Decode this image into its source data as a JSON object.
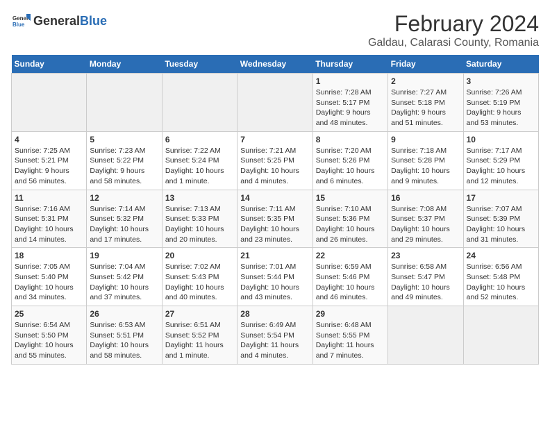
{
  "header": {
    "logo_general": "General",
    "logo_blue": "Blue",
    "title": "February 2024",
    "subtitle": "Galdau, Calarasi County, Romania"
  },
  "weekdays": [
    "Sunday",
    "Monday",
    "Tuesday",
    "Wednesday",
    "Thursday",
    "Friday",
    "Saturday"
  ],
  "weeks": [
    [
      {
        "day": "",
        "info": ""
      },
      {
        "day": "",
        "info": ""
      },
      {
        "day": "",
        "info": ""
      },
      {
        "day": "",
        "info": ""
      },
      {
        "day": "1",
        "info": "Sunrise: 7:28 AM\nSunset: 5:17 PM\nDaylight: 9 hours\nand 48 minutes."
      },
      {
        "day": "2",
        "info": "Sunrise: 7:27 AM\nSunset: 5:18 PM\nDaylight: 9 hours\nand 51 minutes."
      },
      {
        "day": "3",
        "info": "Sunrise: 7:26 AM\nSunset: 5:19 PM\nDaylight: 9 hours\nand 53 minutes."
      }
    ],
    [
      {
        "day": "4",
        "info": "Sunrise: 7:25 AM\nSunset: 5:21 PM\nDaylight: 9 hours\nand 56 minutes."
      },
      {
        "day": "5",
        "info": "Sunrise: 7:23 AM\nSunset: 5:22 PM\nDaylight: 9 hours\nand 58 minutes."
      },
      {
        "day": "6",
        "info": "Sunrise: 7:22 AM\nSunset: 5:24 PM\nDaylight: 10 hours\nand 1 minute."
      },
      {
        "day": "7",
        "info": "Sunrise: 7:21 AM\nSunset: 5:25 PM\nDaylight: 10 hours\nand 4 minutes."
      },
      {
        "day": "8",
        "info": "Sunrise: 7:20 AM\nSunset: 5:26 PM\nDaylight: 10 hours\nand 6 minutes."
      },
      {
        "day": "9",
        "info": "Sunrise: 7:18 AM\nSunset: 5:28 PM\nDaylight: 10 hours\nand 9 minutes."
      },
      {
        "day": "10",
        "info": "Sunrise: 7:17 AM\nSunset: 5:29 PM\nDaylight: 10 hours\nand 12 minutes."
      }
    ],
    [
      {
        "day": "11",
        "info": "Sunrise: 7:16 AM\nSunset: 5:31 PM\nDaylight: 10 hours\nand 14 minutes."
      },
      {
        "day": "12",
        "info": "Sunrise: 7:14 AM\nSunset: 5:32 PM\nDaylight: 10 hours\nand 17 minutes."
      },
      {
        "day": "13",
        "info": "Sunrise: 7:13 AM\nSunset: 5:33 PM\nDaylight: 10 hours\nand 20 minutes."
      },
      {
        "day": "14",
        "info": "Sunrise: 7:11 AM\nSunset: 5:35 PM\nDaylight: 10 hours\nand 23 minutes."
      },
      {
        "day": "15",
        "info": "Sunrise: 7:10 AM\nSunset: 5:36 PM\nDaylight: 10 hours\nand 26 minutes."
      },
      {
        "day": "16",
        "info": "Sunrise: 7:08 AM\nSunset: 5:37 PM\nDaylight: 10 hours\nand 29 minutes."
      },
      {
        "day": "17",
        "info": "Sunrise: 7:07 AM\nSunset: 5:39 PM\nDaylight: 10 hours\nand 31 minutes."
      }
    ],
    [
      {
        "day": "18",
        "info": "Sunrise: 7:05 AM\nSunset: 5:40 PM\nDaylight: 10 hours\nand 34 minutes."
      },
      {
        "day": "19",
        "info": "Sunrise: 7:04 AM\nSunset: 5:42 PM\nDaylight: 10 hours\nand 37 minutes."
      },
      {
        "day": "20",
        "info": "Sunrise: 7:02 AM\nSunset: 5:43 PM\nDaylight: 10 hours\nand 40 minutes."
      },
      {
        "day": "21",
        "info": "Sunrise: 7:01 AM\nSunset: 5:44 PM\nDaylight: 10 hours\nand 43 minutes."
      },
      {
        "day": "22",
        "info": "Sunrise: 6:59 AM\nSunset: 5:46 PM\nDaylight: 10 hours\nand 46 minutes."
      },
      {
        "day": "23",
        "info": "Sunrise: 6:58 AM\nSunset: 5:47 PM\nDaylight: 10 hours\nand 49 minutes."
      },
      {
        "day": "24",
        "info": "Sunrise: 6:56 AM\nSunset: 5:48 PM\nDaylight: 10 hours\nand 52 minutes."
      }
    ],
    [
      {
        "day": "25",
        "info": "Sunrise: 6:54 AM\nSunset: 5:50 PM\nDaylight: 10 hours\nand 55 minutes."
      },
      {
        "day": "26",
        "info": "Sunrise: 6:53 AM\nSunset: 5:51 PM\nDaylight: 10 hours\nand 58 minutes."
      },
      {
        "day": "27",
        "info": "Sunrise: 6:51 AM\nSunset: 5:52 PM\nDaylight: 11 hours\nand 1 minute."
      },
      {
        "day": "28",
        "info": "Sunrise: 6:49 AM\nSunset: 5:54 PM\nDaylight: 11 hours\nand 4 minutes."
      },
      {
        "day": "29",
        "info": "Sunrise: 6:48 AM\nSunset: 5:55 PM\nDaylight: 11 hours\nand 7 minutes."
      },
      {
        "day": "",
        "info": ""
      },
      {
        "day": "",
        "info": ""
      }
    ]
  ]
}
